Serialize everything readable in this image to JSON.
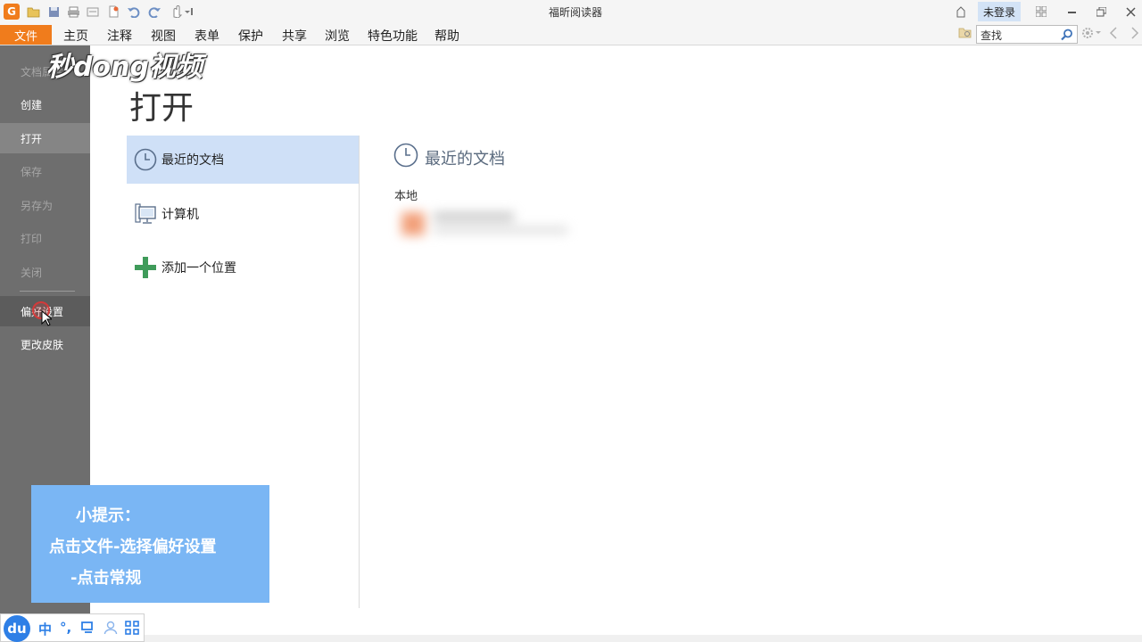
{
  "window": {
    "title": "福昕阅读器",
    "login": "未登录"
  },
  "menu": {
    "file": "文件",
    "items": [
      "主页",
      "注释",
      "视图",
      "表单",
      "保护",
      "共享",
      "浏览",
      "特色功能",
      "帮助"
    ]
  },
  "search": {
    "value": "查找"
  },
  "watermark": "秒dong视频",
  "sidebar": {
    "items": [
      {
        "label": "文档属性"
      },
      {
        "label": "创建"
      },
      {
        "label": "打开"
      },
      {
        "label": "保存"
      },
      {
        "label": "另存为"
      },
      {
        "label": "打印"
      },
      {
        "label": "关闭"
      },
      {
        "label": "偏好设置"
      },
      {
        "label": "更改皮肤"
      }
    ]
  },
  "main": {
    "title": "打开",
    "locations": [
      {
        "label": "最近的文档"
      },
      {
        "label": "计算机"
      },
      {
        "label": "添加一个位置"
      }
    ],
    "recent_heading": "最近的文档",
    "local_label": "本地"
  },
  "tip": {
    "line1": "小提示：",
    "line2": "点击文件-选择偏好设置",
    "line3": "-点击常规"
  },
  "tray": {
    "logo": "du",
    "lang": "中",
    "punct": "°,"
  },
  "colors": {
    "accent": "#f07c1c",
    "sidebar": "#6e6e6e",
    "active_location": "#cfe0f7",
    "tip_box": "#7ab6f4"
  }
}
